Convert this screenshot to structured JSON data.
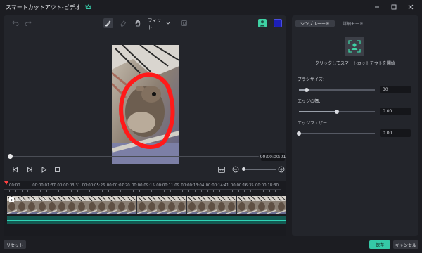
{
  "window": {
    "title": "スマートカットアウト-ビデオ",
    "controls": [
      "minimize",
      "maximize",
      "close"
    ]
  },
  "toolbar": {
    "fit_label": "フィット",
    "swatch_colors": [
      "#3fd2a4",
      "#1c1fb8"
    ]
  },
  "player": {
    "timecode": "00:00:00:01"
  },
  "timeline": {
    "ticks": [
      "00:00",
      "00:00:01:37",
      "00:00:03:31",
      "00:00:05:26",
      "00:00:07:20",
      "00:00:09:15",
      "00:00:11:09",
      "00:00:13:04",
      "00:00:14:41",
      "00:00:16:35",
      "00:00:18:30"
    ],
    "clip_label": "0101 .0101 140..."
  },
  "panel": {
    "tabs": [
      {
        "label": "シンプルモード",
        "active": true
      },
      {
        "label": "詳細モード",
        "active": false
      }
    ],
    "hint": "クリックしてスマートカットアウトを開始",
    "params": [
      {
        "label": "ブラシサイズ：",
        "value": "30",
        "fraction": 0.1
      },
      {
        "label": "エッジの幅：",
        "value": "0.00",
        "fraction": 0.5
      },
      {
        "label": "エッジフェザー：",
        "value": "0.00",
        "fraction": 0.0
      }
    ]
  },
  "buttons": {
    "reset": "リセット",
    "save": "保存",
    "cancel": "キャンセル"
  },
  "colors": {
    "accent": "#35c9a7",
    "mask_red": "#ff1a1a",
    "playhead": "#ff4a4a"
  }
}
